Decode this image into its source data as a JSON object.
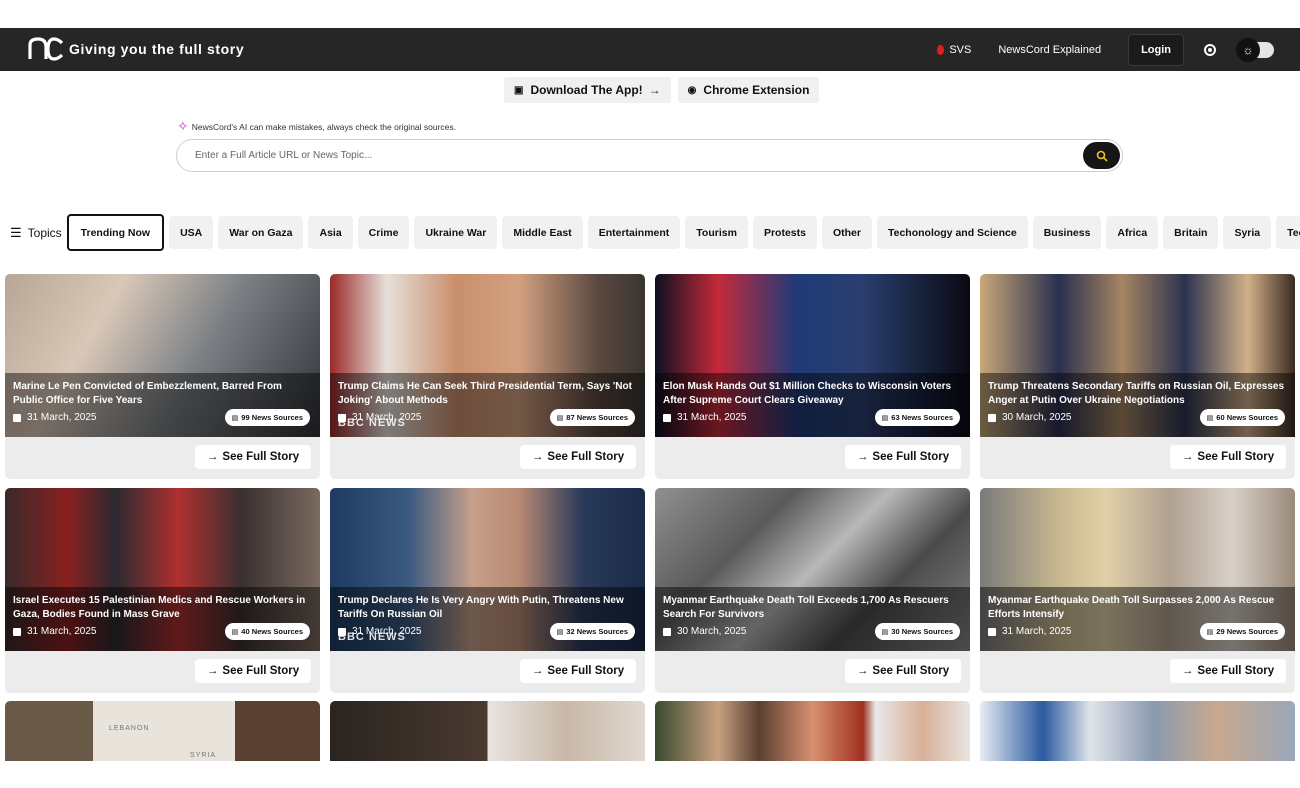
{
  "header": {
    "tagline": "Giving you the full story",
    "location": "SVS",
    "explained": "NewsCord Explained",
    "login": "Login"
  },
  "promo": {
    "download": "Download The App!",
    "chrome": "Chrome Extension"
  },
  "ai_note": "NewsCord's AI can make mistakes, always check the original sources.",
  "search": {
    "placeholder": "Enter a Full Article URL or News Topic..."
  },
  "topics": {
    "label": "Topics",
    "items": [
      "Trending Now",
      "USA",
      "War on Gaza",
      "Asia",
      "Crime",
      "Ukraine War",
      "Middle East",
      "Entertainment",
      "Tourism",
      "Protests",
      "Other",
      "Techonology and Science",
      "Business",
      "Africa",
      "Britain",
      "Syria",
      "Technology and"
    ]
  },
  "cards": [
    {
      "title": "Marine Le Pen Convicted of Embezzlement, Barred From Public Office for Five Years",
      "date": "31 March, 2025",
      "sources": "99 News Sources",
      "cta": "See Full Story",
      "watermark": "",
      "bg": "#6f7478"
    },
    {
      "title": "Trump Claims He Can Seek Third Presidential Term, Says 'Not Joking' About Methods",
      "date": "31 March, 2025",
      "sources": "87 News Sources",
      "cta": "See Full Story",
      "watermark": "BBC NEWS",
      "bg": "#7a5448"
    },
    {
      "title": "Elon Musk Hands Out $1 Million Checks to Wisconsin Voters After Supreme Court Clears Giveaway",
      "date": "31 March, 2025",
      "sources": "63 News Sources",
      "cta": "See Full Story",
      "watermark": "",
      "bg": "#263248"
    },
    {
      "title": "Trump Threatens Secondary Tariffs on Russian Oil, Expresses Anger at Putin Over Ukraine Negotiations",
      "date": "30 March, 2025",
      "sources": "60 News Sources",
      "cta": "See Full Story",
      "watermark": "",
      "bg": "#8a6a4a"
    },
    {
      "title": "Israel Executes 15 Palestinian Medics and Rescue Workers in Gaza, Bodies Found in Mass Grave",
      "date": "31 March, 2025",
      "sources": "40 News Sources",
      "cta": "See Full Story",
      "watermark": "",
      "bg": "#6b3a3a"
    },
    {
      "title": "Trump Declares He Is Very Angry With Putin, Threatens New Tariffs On Russian Oil",
      "date": "31 March, 2025",
      "sources": "32 News Sources",
      "cta": "See Full Story",
      "watermark": "BBC NEWS",
      "bg": "#3c5878"
    },
    {
      "title": "Myanmar Earthquake Death Toll Exceeds 1,700 As Rescuers Search For Survivors",
      "date": "30 March, 2025",
      "sources": "30 News Sources",
      "cta": "See Full Story",
      "watermark": "",
      "bg": "#6a6a6a"
    },
    {
      "title": "Myanmar Earthquake Death Toll Surpasses 2,000 As Rescue Efforts Intensify",
      "date": "31 March, 2025",
      "sources": "29 News Sources",
      "cta": "See Full Story",
      "watermark": "",
      "bg": "#8c7e6e"
    }
  ],
  "partial_cards": [
    {
      "bg": "#d8d4cc",
      "labels": [
        "LEBANON",
        "SYRIA"
      ]
    },
    {
      "bg": "#4a4038"
    },
    {
      "bg": "#5a4a3c"
    },
    {
      "bg": "#8a9ab0"
    }
  ]
}
